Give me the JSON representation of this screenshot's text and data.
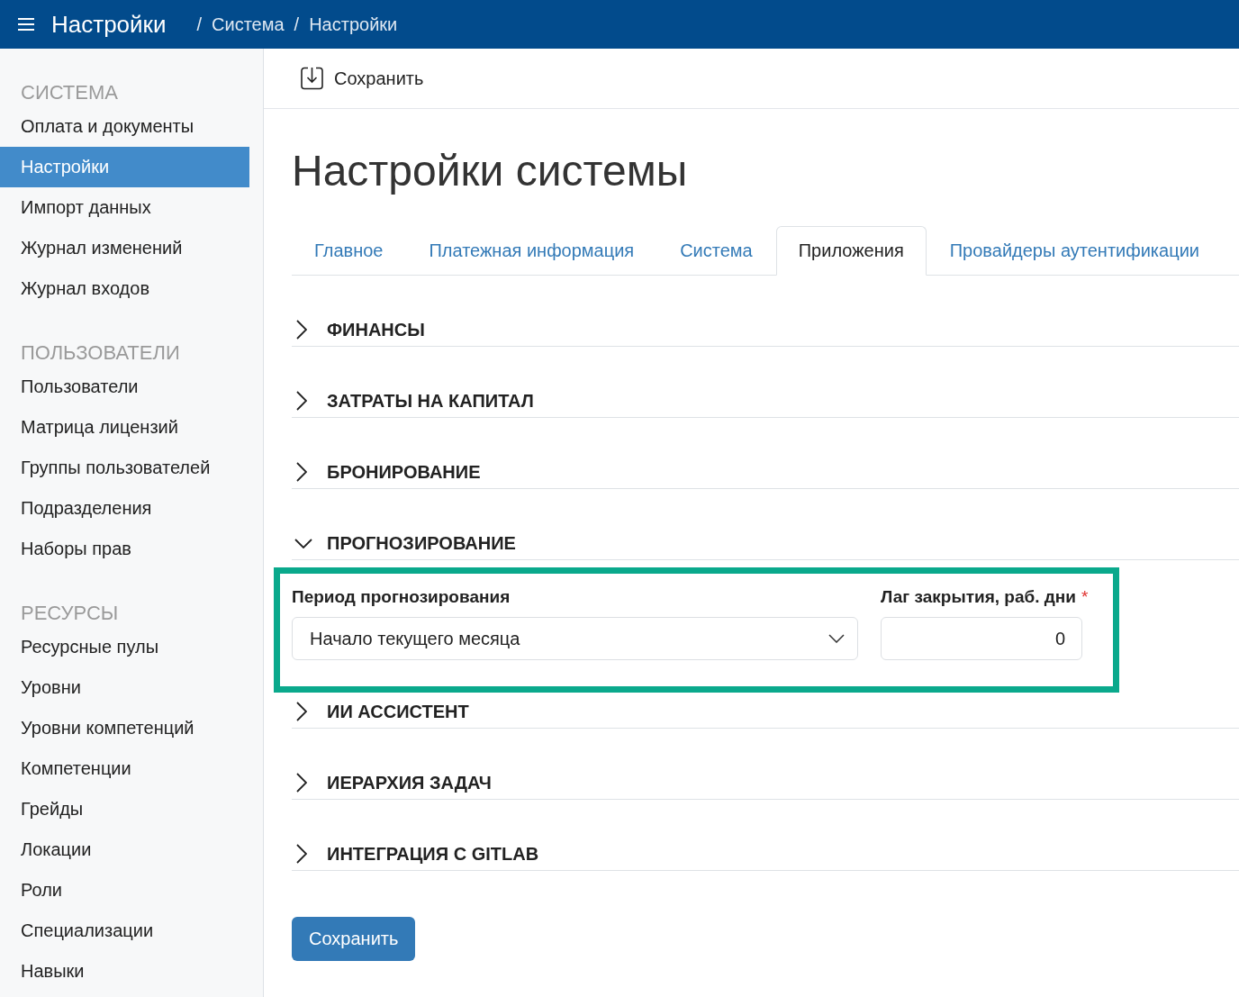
{
  "header": {
    "title": "Настройки",
    "breadcrumbs": [
      {
        "separator": "/",
        "label": "Система"
      },
      {
        "separator": "/",
        "label": "Настройки"
      }
    ]
  },
  "sidebar": {
    "sections": [
      {
        "heading": "СИСТЕМА",
        "items": [
          {
            "label": "Оплата и документы",
            "selected": false
          },
          {
            "label": "Настройки",
            "selected": true
          },
          {
            "label": "Импорт данных",
            "selected": false
          },
          {
            "label": "Журнал изменений",
            "selected": false
          },
          {
            "label": "Журнал входов",
            "selected": false
          }
        ]
      },
      {
        "heading": "ПОЛЬЗОВАТЕЛИ",
        "items": [
          {
            "label": "Пользователи",
            "selected": false
          },
          {
            "label": "Матрица лицензий",
            "selected": false
          },
          {
            "label": "Группы пользователей",
            "selected": false
          },
          {
            "label": "Подразделения",
            "selected": false
          },
          {
            "label": "Наборы прав",
            "selected": false
          }
        ]
      },
      {
        "heading": "РЕСУРСЫ",
        "items": [
          {
            "label": "Ресурсные пулы",
            "selected": false
          },
          {
            "label": "Уровни",
            "selected": false
          },
          {
            "label": "Уровни компетенций",
            "selected": false
          },
          {
            "label": "Компетенции",
            "selected": false
          },
          {
            "label": "Грейды",
            "selected": false
          },
          {
            "label": "Локации",
            "selected": false
          },
          {
            "label": "Роли",
            "selected": false
          },
          {
            "label": "Специализации",
            "selected": false
          },
          {
            "label": "Навыки",
            "selected": false
          }
        ]
      }
    ]
  },
  "toolbar": {
    "save_label": "Сохранить"
  },
  "page_title": "Настройки системы",
  "tabs": [
    {
      "label": "Главное",
      "selected": false
    },
    {
      "label": "Платежная информация",
      "selected": false
    },
    {
      "label": "Система",
      "selected": false
    },
    {
      "label": "Приложения",
      "selected": true
    },
    {
      "label": "Провайдеры аутентификации",
      "selected": false
    }
  ],
  "sections": [
    {
      "title": "ФИНАНСЫ",
      "expanded": false
    },
    {
      "title": "ЗАТРАТЫ НА КАПИТАЛ",
      "expanded": false
    },
    {
      "title": "БРОНИРОВАНИЕ",
      "expanded": false
    },
    {
      "title": "ПРОГНОЗИРОВАНИЕ",
      "expanded": true,
      "content": {
        "highlighted": true,
        "fields": [
          {
            "kind": "select",
            "label": "Период прогнозирования",
            "value": "Начало текущего месяца"
          },
          {
            "kind": "number",
            "label": "Лаг закрытия, раб. дни",
            "required_mark": "*",
            "value": "0"
          }
        ]
      }
    },
    {
      "title": "ИИ АССИСТЕНТ",
      "expanded": false
    },
    {
      "title": "ИЕРАРХИЯ ЗАДАЧ",
      "expanded": false
    },
    {
      "title": "ИНТЕГРАЦИЯ С GITLAB",
      "expanded": false
    }
  ],
  "footer": {
    "save_label": "Сохранить"
  }
}
